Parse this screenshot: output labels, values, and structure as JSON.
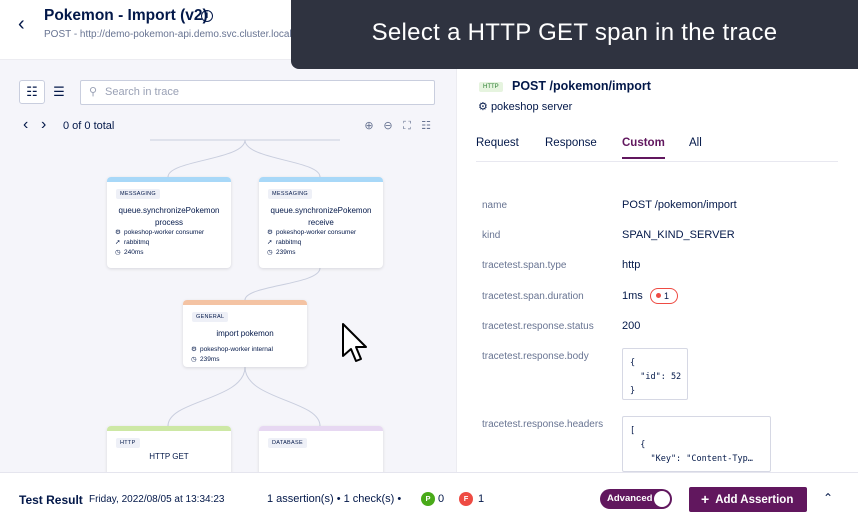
{
  "header": {
    "title": "Pokemon - Import (v2)",
    "subtitle": "POST - http://demo-pokemon-api.demo.svc.cluster.local",
    "info_icon": "info-icon"
  },
  "tooltip": "Select a HTTP GET span in the trace",
  "left": {
    "search_placeholder": "Search in trace",
    "nav_count": "0 of 0 total",
    "nodes": [
      {
        "type": "MESSAGING",
        "name": "queue.synchronizePokemon process",
        "service": "pokeshop-worker consumer",
        "system": "rabbitmq",
        "duration": "240ms",
        "color": "#a8d8f8"
      },
      {
        "type": "MESSAGING",
        "name": "queue.synchronizePokemon receive",
        "service": "pokeshop-worker consumer",
        "system": "rabbitmq",
        "duration": "239ms",
        "color": "#a8d8f8"
      },
      {
        "type": "GENERAL",
        "name": "import pokemon",
        "service": "pokeshop-worker internal",
        "duration": "239ms",
        "color": "#f4c3a3"
      },
      {
        "type": "HTTP",
        "name": "HTTP GET",
        "color": "#cde8a5"
      },
      {
        "type": "DATABASE",
        "name": "",
        "color": "#e7d8f2"
      }
    ]
  },
  "right": {
    "badge": "HTTP",
    "span_title": "POST /pokemon/import",
    "service": "pokeshop server",
    "tabs": [
      "Request",
      "Response",
      "Custom",
      "All"
    ],
    "active_tab": "Custom",
    "attributes": [
      {
        "key": "name",
        "value": "POST /pokemon/import"
      },
      {
        "key": "kind",
        "value": "SPAN_KIND_SERVER"
      },
      {
        "key": "tracetest.span.type",
        "value": "http"
      },
      {
        "key": "tracetest.span.duration",
        "value": "1ms",
        "badge": "1"
      },
      {
        "key": "tracetest.response.status",
        "value": "200"
      },
      {
        "key": "tracetest.response.body",
        "code": "{\n  \"id\": 52\n}"
      },
      {
        "key": "tracetest.response.headers",
        "code": "[\n  {\n    \"Key\": \"Content-Typ…"
      }
    ]
  },
  "footer": {
    "title": "Test Result",
    "date": "Friday, 2022/08/05 at 13:34:23",
    "summary": "1 assertion(s) • 1 check(s) •",
    "pass_label": "P",
    "pass_count": "0",
    "fail_label": "F",
    "fail_count": "1",
    "advanced_label": "Advanced",
    "add_assertion_label": "Add Assertion"
  }
}
